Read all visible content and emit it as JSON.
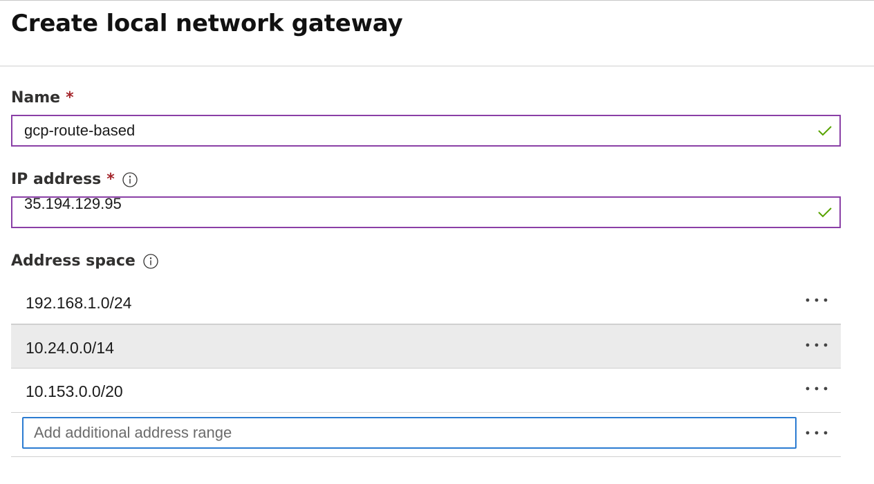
{
  "title": "Create local network gateway",
  "name_field": {
    "label": "Name",
    "required_mark": "*",
    "value": "gcp-route-based",
    "valid_icon": "checkmark-icon"
  },
  "ip_field": {
    "label": "IP address",
    "required_mark": "*",
    "value": "35.194.129.95",
    "info_icon": "info-icon",
    "valid_icon": "checkmark-icon"
  },
  "address_space": {
    "label": "Address space",
    "info_icon": "info-icon",
    "rows": [
      {
        "value": "192.168.1.0/24",
        "selected": false
      },
      {
        "value": "10.24.0.0/14",
        "selected": true
      },
      {
        "value": "10.153.0.0/20",
        "selected": false
      }
    ],
    "add_placeholder": "Add additional address range",
    "add_value": "",
    "more_icon": "more-ellipsis-icon"
  },
  "colors": {
    "focus_purple": "#8a3fa6",
    "focus_blue": "#2a7bd1",
    "required_red": "#a4262c",
    "valid_green": "#57a300",
    "selected_row": "#ebebeb"
  }
}
